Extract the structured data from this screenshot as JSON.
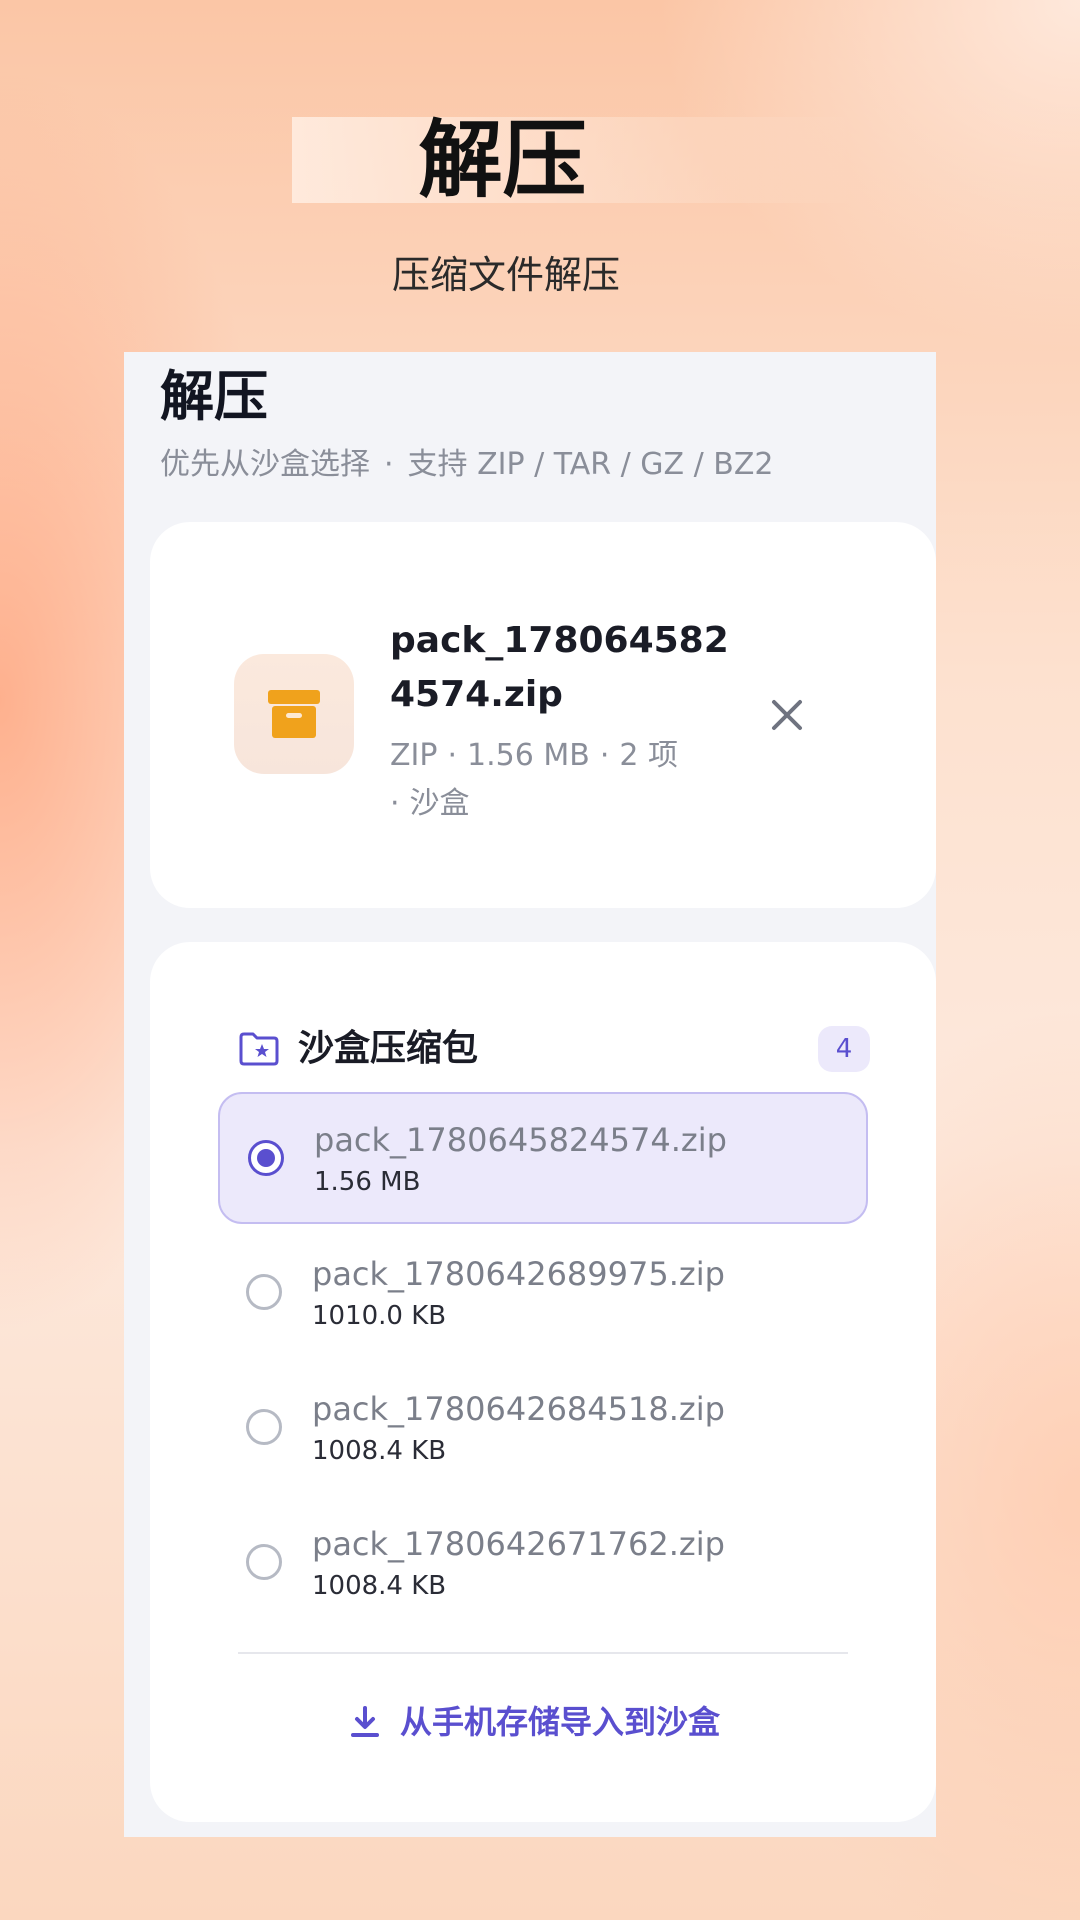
{
  "promo": {
    "title": "解压",
    "subtitle": "压缩文件解压"
  },
  "screen": {
    "title": "解压",
    "subtitle_source": "优先从沙盒选择",
    "subtitle_sep": "·",
    "subtitle_formats": "支持 ZIP / TAR / GZ / BZ2"
  },
  "selected_file": {
    "icon": "archive-box-icon",
    "name": "pack_1780645824574.zip",
    "type": "ZIP",
    "size": "1.56 MB",
    "items": "2 项",
    "location": "沙盒",
    "sep": "·"
  },
  "sandbox_list": {
    "icon": "folder-star-icon",
    "title": "沙盒压缩包",
    "count": "4",
    "items": [
      {
        "name": "pack_1780645824574.zip",
        "size": "1.56 MB",
        "selected": true
      },
      {
        "name": "pack_1780642689975.zip",
        "size": "1010.0 KB",
        "selected": false
      },
      {
        "name": "pack_1780642684518.zip",
        "size": "1008.4 KB",
        "selected": false
      },
      {
        "name": "pack_1780642671762.zip",
        "size": "1008.4 KB",
        "selected": false
      }
    ],
    "import_icon": "download-icon",
    "import_label": "从手机存储导入到沙盒"
  },
  "colors": {
    "accent": "#5a4fcf",
    "archive_icon": "#f0a21c",
    "selected_bg": "#ece9fb"
  }
}
